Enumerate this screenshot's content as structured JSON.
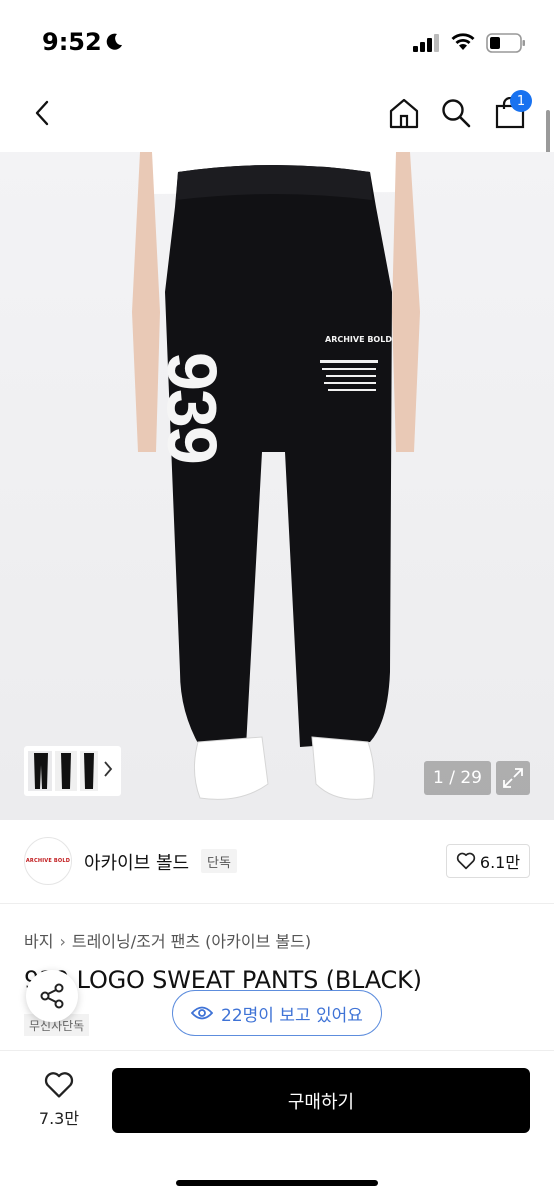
{
  "status_bar": {
    "time": "9:52"
  },
  "nav": {
    "cart_badge": "1"
  },
  "product_image": {
    "counter": "1 / 29",
    "print_number": "939",
    "print_brand": "ARCHIVE BOLD"
  },
  "brand": {
    "logo_text": "ARCHIVE BOLD",
    "name": "아카이브 볼드",
    "exclusive_tag": "단독",
    "likes": "6.1만"
  },
  "breadcrumb": [
    "바지",
    "트레이닝/조거 팬츠 (아카이브 볼드)"
  ],
  "product": {
    "title": "939 LOGO SWEAT PANTS (BLACK)",
    "tag": "무신사단독"
  },
  "viewers": {
    "text": "22명이 보고 있어요"
  },
  "bottom_bar": {
    "wish_count": "7.3만",
    "buy_label": "구매하기"
  },
  "colors": {
    "accent_blue": "#1872f0",
    "viewer_blue": "#3f73d6",
    "buy_bg": "#000000"
  },
  "icons": [
    "moon-icon",
    "signal-icon",
    "wifi-icon",
    "battery-icon",
    "back-icon",
    "home-icon",
    "search-icon",
    "bag-icon",
    "chevron-right-icon",
    "expand-icon",
    "heart-icon",
    "share-icon",
    "eye-icon"
  ]
}
